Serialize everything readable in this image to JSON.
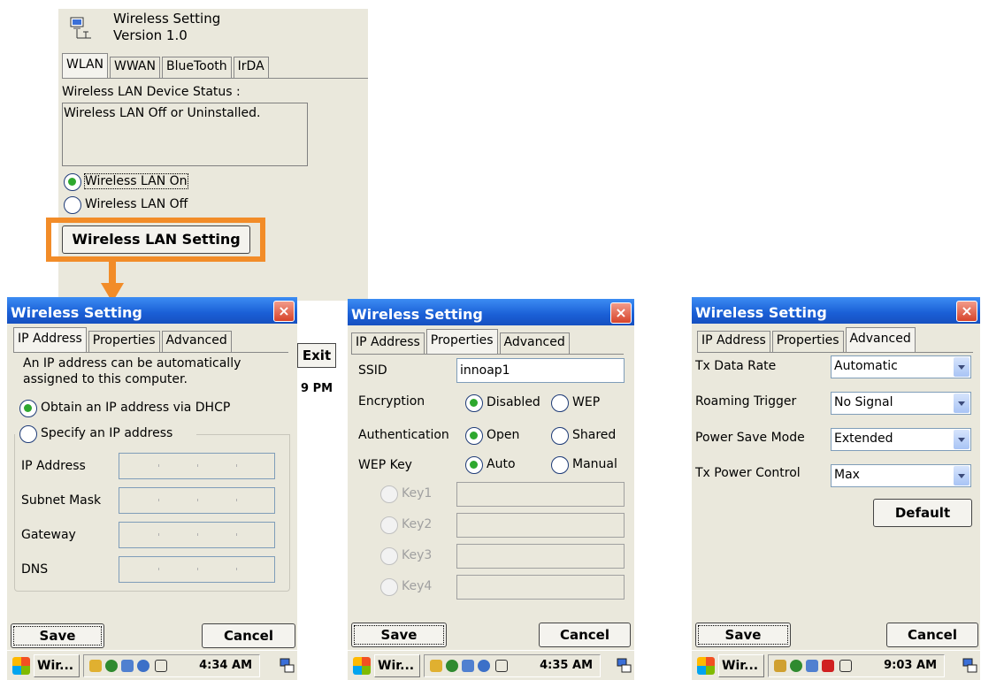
{
  "main": {
    "title": "Wireless Setting",
    "version": "Version 1.0",
    "tabs": [
      "WLAN",
      "WWAN",
      "BlueTooth",
      "IrDA"
    ],
    "status_label": "Wireless LAN Device Status :",
    "status_text": "Wireless LAN Off or Uninstalled.",
    "radio_on": "Wireless LAN On",
    "radio_off": "Wireless LAN Off",
    "setting_button": "Wireless LAN Setting",
    "exit_button": "Exit",
    "clock_partial": "9 PM"
  },
  "highlight_color": "#f28c28",
  "dlg1": {
    "title": "Wireless Setting",
    "close": "×",
    "tabs": [
      "IP Address",
      "Properties",
      "Advanced"
    ],
    "desc1": "An IP address can be automatically",
    "desc2": "assigned to this computer.",
    "opt_dhcp": "Obtain an IP address via DHCP",
    "opt_specify": "Specify an IP address",
    "fields": [
      "IP Address",
      "Subnet Mask",
      "Gateway",
      "DNS"
    ],
    "save": "Save",
    "cancel": "Cancel",
    "taskbar": {
      "app": "Wir...",
      "time": "4:34 AM"
    }
  },
  "dlg2": {
    "title": "Wireless Setting",
    "close": "×",
    "tabs": [
      "IP Address",
      "Properties",
      "Advanced"
    ],
    "ssid_label": "SSID",
    "ssid_value": "innoap1",
    "enc_label": "Encryption",
    "enc_opt1": "Disabled",
    "enc_opt2": "WEP",
    "auth_label": "Authentication",
    "auth_opt1": "Open",
    "auth_opt2": "Shared",
    "wep_label": "WEP Key",
    "wep_opt1": "Auto",
    "wep_opt2": "Manual",
    "keys": [
      "Key1",
      "Key2",
      "Key3",
      "Key4"
    ],
    "save": "Save",
    "cancel": "Cancel",
    "taskbar": {
      "app": "Wir...",
      "time": "4:35 AM"
    }
  },
  "dlg3": {
    "title": "Wireless Setting",
    "close": "×",
    "tabs": [
      "IP Address",
      "Properties",
      "Advanced"
    ],
    "rows": [
      {
        "label": "Tx Data Rate",
        "value": "Automatic"
      },
      {
        "label": "Roaming Trigger",
        "value": "No Signal"
      },
      {
        "label": "Power Save Mode",
        "value": "Extended"
      },
      {
        "label": "Tx Power Control",
        "value": "Max"
      }
    ],
    "default": "Default",
    "save": "Save",
    "cancel": "Cancel",
    "taskbar": {
      "app": "Wir...",
      "time": "9:03 AM"
    }
  }
}
